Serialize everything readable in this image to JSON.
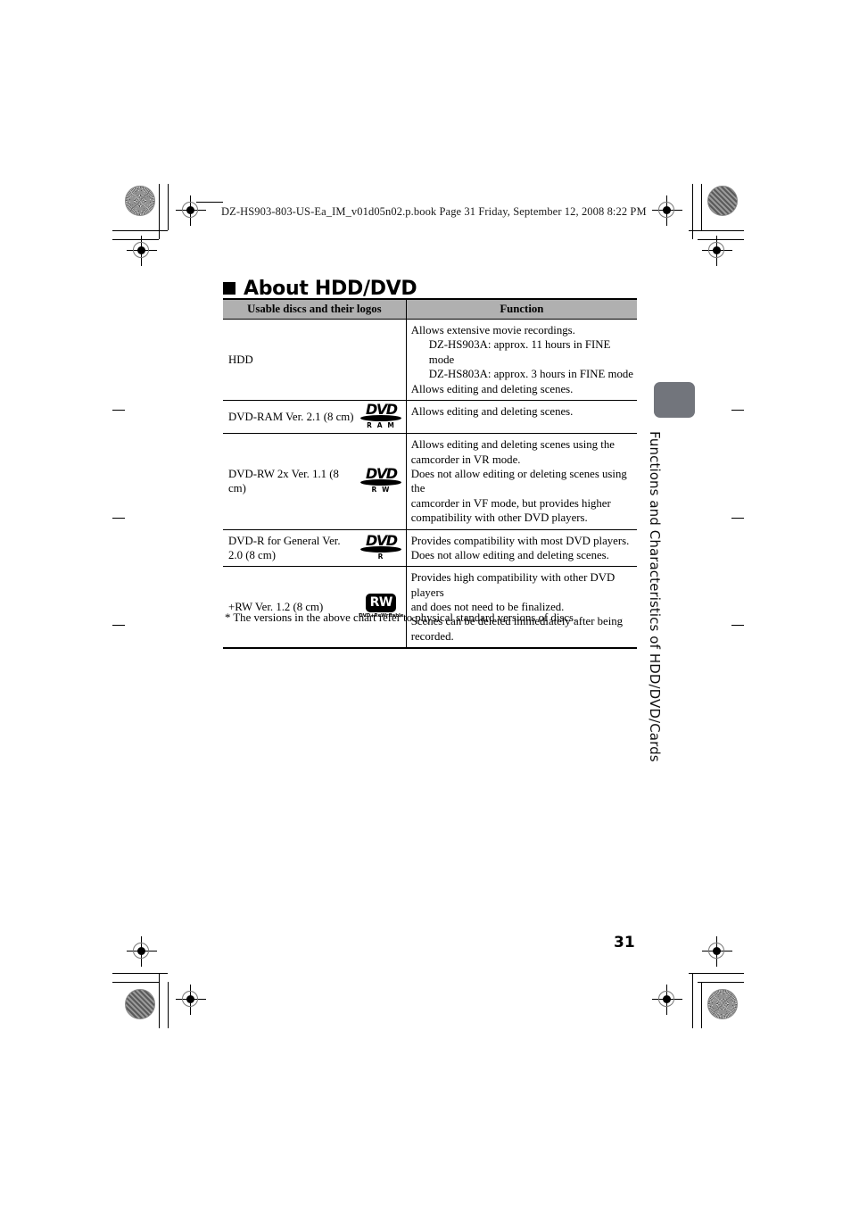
{
  "page": {
    "header_line": "DZ-HS903-803-US-Ea_IM_v01d05n02.p.book  Page 31  Friday, September 12, 2008  8:22 PM",
    "number": "31",
    "chapter_tab_label": "Functions and Characteristics of HDD/DVD/Cards"
  },
  "section": {
    "title": "About HDD/DVD"
  },
  "table": {
    "headers": {
      "discs": "Usable discs and their logos",
      "function": "Function"
    },
    "rows": [
      {
        "name": "HDD",
        "logo": null,
        "function_lines": [
          {
            "text": "Allows extensive movie recordings.",
            "indent": false
          },
          {
            "text": "DZ-HS903A: approx. 11 hours in FINE mode",
            "indent": true
          },
          {
            "text": "DZ-HS803A: approx. 3 hours in FINE mode",
            "indent": true
          },
          {
            "text": "Allows editing and deleting scenes.",
            "indent": false
          }
        ]
      },
      {
        "name": "DVD-RAM Ver. 2.1 (8 cm)",
        "logo": {
          "type": "dvd",
          "word": "DVD",
          "sub": "R A M"
        },
        "function_lines": [
          {
            "text": "Allows editing and deleting scenes.",
            "indent": false
          }
        ]
      },
      {
        "name": "DVD-RW 2x Ver. 1.1 (8 cm)",
        "logo": {
          "type": "dvd",
          "word": "DVD",
          "sub": "R W"
        },
        "function_lines": [
          {
            "text": "Allows editing and deleting scenes using the",
            "indent": false
          },
          {
            "text": "camcorder in VR mode.",
            "indent": false
          },
          {
            "text": "Does not allow editing or deleting scenes using the",
            "indent": false
          },
          {
            "text": "camcorder in VF mode, but provides higher",
            "indent": false
          },
          {
            "text": "compatibility with other DVD players.",
            "indent": false
          }
        ]
      },
      {
        "name": "DVD-R for General Ver. 2.0 (8 cm)",
        "logo": {
          "type": "dvd",
          "word": "DVD",
          "sub": "R"
        },
        "function_lines": [
          {
            "text": "Provides compatibility with most DVD players.",
            "indent": false
          },
          {
            "text": "Does not allow editing and deleting scenes.",
            "indent": false
          }
        ]
      },
      {
        "name": "+RW Ver. 1.2 (8 cm)",
        "logo": {
          "type": "rw",
          "word": "RW",
          "sub": "DVD+ReWritable"
        },
        "function_lines": [
          {
            "text": "Provides high compatibility with other DVD players",
            "indent": false
          },
          {
            "text": "and does not need to be finalized.",
            "indent": false
          },
          {
            "text": "Scenes can be deleted immediately after being",
            "indent": false
          },
          {
            "text": "recorded.",
            "indent": false
          }
        ]
      }
    ],
    "footnote": "* The versions in the above chart refer to physical standard versions of discs."
  },
  "colors": {
    "table_header_gray": "#b0b0b0",
    "side_tab_gray": "#72757c",
    "rule_black": "#000000"
  }
}
